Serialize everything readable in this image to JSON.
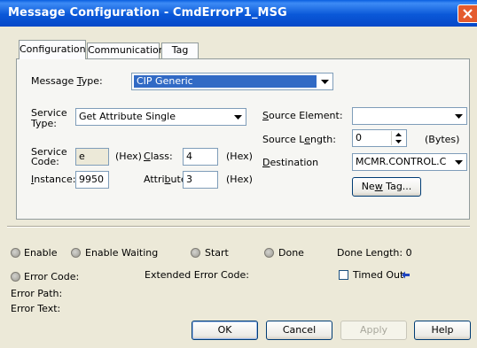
{
  "window": {
    "title": "Message Configuration - CmdErrorP1_MSG"
  },
  "tabs": [
    {
      "label": "Configuration",
      "active": true
    },
    {
      "label": "Communication",
      "active": false
    },
    {
      "label": "Tag",
      "active": false
    }
  ],
  "config": {
    "message_type_label": "Message Type:",
    "message_type_value": "CIP Generic",
    "service_type_label_1": "Service",
    "service_type_label_2": "Type:",
    "service_type_value": "Get Attribute Single",
    "service_code_label_1": "Service",
    "service_code_label_2": "Code:",
    "service_code_value": "e",
    "hex": "(Hex)",
    "class_label": "Class:",
    "class_value": "4",
    "instance_label": "Instance:",
    "instance_value": "9950",
    "attribute_label": "Attribute:",
    "attribute_value": "3",
    "source_element_label": "Source Element:",
    "source_element_value": "",
    "source_length_label": "Source Length:",
    "source_length_value": "0",
    "bytes_label": "(Bytes)",
    "destination_label": "Destination",
    "destination_value": "MCMR.CONTROL.C",
    "new_tag_button": "New Tag..."
  },
  "status": {
    "enable": "Enable",
    "enable_waiting": "Enable Waiting",
    "start": "Start",
    "done": "Done",
    "done_length": "Done Length: 0",
    "error_code": "Error Code:",
    "extended_error_code": "Extended Error Code:",
    "timed_out": "Timed Out",
    "error_path": "Error Path:",
    "error_text": "Error Text:"
  },
  "buttons": {
    "ok": "OK",
    "cancel": "Cancel",
    "apply": "Apply",
    "help": "Help"
  },
  "colors": {
    "titlebar": "#0A58D8",
    "highlight": "#316AC5",
    "close": "#E45B2E"
  }
}
